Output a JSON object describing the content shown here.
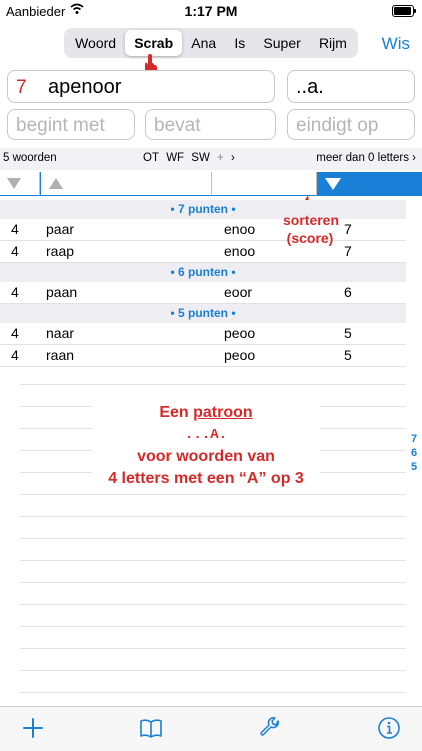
{
  "status": {
    "carrier": "Aanbieder",
    "time": "1:17 PM"
  },
  "modes": [
    "Woord",
    "Scrab",
    "Ana",
    "Is",
    "Super",
    "Rijm"
  ],
  "selected_mode": "Scrab",
  "clear_label": "Wis",
  "letters": {
    "count": "7",
    "value": "apenoor"
  },
  "pattern": "..a.",
  "filters": {
    "begin": "begint met",
    "contains": "bevat",
    "ends": "eindigt op"
  },
  "info": {
    "word_count": "5 woorden",
    "dict_ot": "OT",
    "dict_wf": "WF",
    "dict_sw": "SW",
    "plus": "+",
    "letters_filter": "meer dan 0 letters"
  },
  "sort_note": {
    "line1": "sorteren",
    "line2": "(score)"
  },
  "sections": [
    {
      "title": "• 7 punten •",
      "rows": [
        {
          "len": "4",
          "word": "paar",
          "rest": "enoo",
          "score": "7"
        },
        {
          "len": "4",
          "word": "raap",
          "rest": "enoo",
          "score": "7"
        }
      ]
    },
    {
      "title": "• 6 punten •",
      "rows": [
        {
          "len": "4",
          "word": "paan",
          "rest": "eoor",
          "score": "6"
        }
      ]
    },
    {
      "title": "• 5 punten •",
      "rows": [
        {
          "len": "4",
          "word": "naar",
          "rest": "peoo",
          "score": "5"
        },
        {
          "len": "4",
          "word": "raan",
          "rest": "peoo",
          "score": "5"
        }
      ]
    }
  ],
  "index": [
    "7",
    "6",
    "5"
  ],
  "callout": {
    "line1_pre": "Een ",
    "line1_u": "patroon",
    "pattern": "...A.",
    "line3": "voor woorden van",
    "line4": "4 letters met een “A” op 3"
  },
  "colors": {
    "accent": "#1a7fd6",
    "annotation": "#d62a2a"
  },
  "tabs": [
    "plus-icon",
    "book-icon",
    "wrench-icon",
    "info-icon"
  ]
}
